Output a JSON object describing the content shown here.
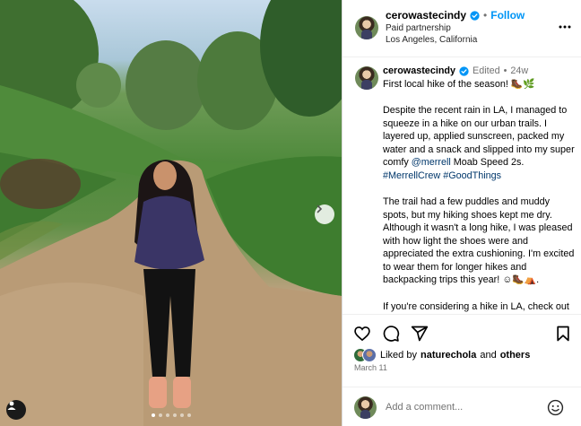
{
  "post": {
    "username": "cerowastecindy",
    "follow_label": "Follow",
    "separator": "•",
    "paid_partnership": "Paid partnership",
    "location": "Los Angeles, California"
  },
  "caption": {
    "username": "cerowastecindy",
    "edited": "Edited",
    "age": "24w",
    "line1": "First local hike of the season! 🥾🌿",
    "p1_text": "Despite the recent rain in LA, I managed to squeeze in a hike on our urban trails. I layered up, applied sunscreen, packed my water and a snack and slipped into my super comfy ",
    "p1_mention": "@merrell",
    "p1_text2": " Moab Speed 2s. ",
    "p1_tags": "#MerrellCrew #GoodThings",
    "p2": "The trail had a few puddles and muddy spots, but my hiking shoes kept me dry. Although it wasn't a long hike, I was pleased with how light the shoes were and appreciated the extra cushioning. I'm excited to wear them for longer hikes and backpacking trips this year! ☺🥾⛺.",
    "p3": "If you're considering a hike in LA, check out the local trails and parks near you!"
  },
  "likes": {
    "prefix": "Liked by",
    "user": "naturechola",
    "and": "and",
    "others": "others"
  },
  "date": "March 11",
  "comment": {
    "placeholder": "Add a comment..."
  },
  "carousel": {
    "slides": 6,
    "active_index": 0
  },
  "icons": {
    "verified": "verified-badge-icon",
    "more": "more-horizontal-icon",
    "like": "heart-icon",
    "comment": "comment-icon",
    "share": "send-icon",
    "save": "bookmark-icon",
    "emoji": "emoji-icon",
    "next": "chevron-right-icon",
    "tags": "user-tag-icon"
  },
  "colors": {
    "link": "#0095f6",
    "mention": "#00376b",
    "muted": "#737373"
  }
}
